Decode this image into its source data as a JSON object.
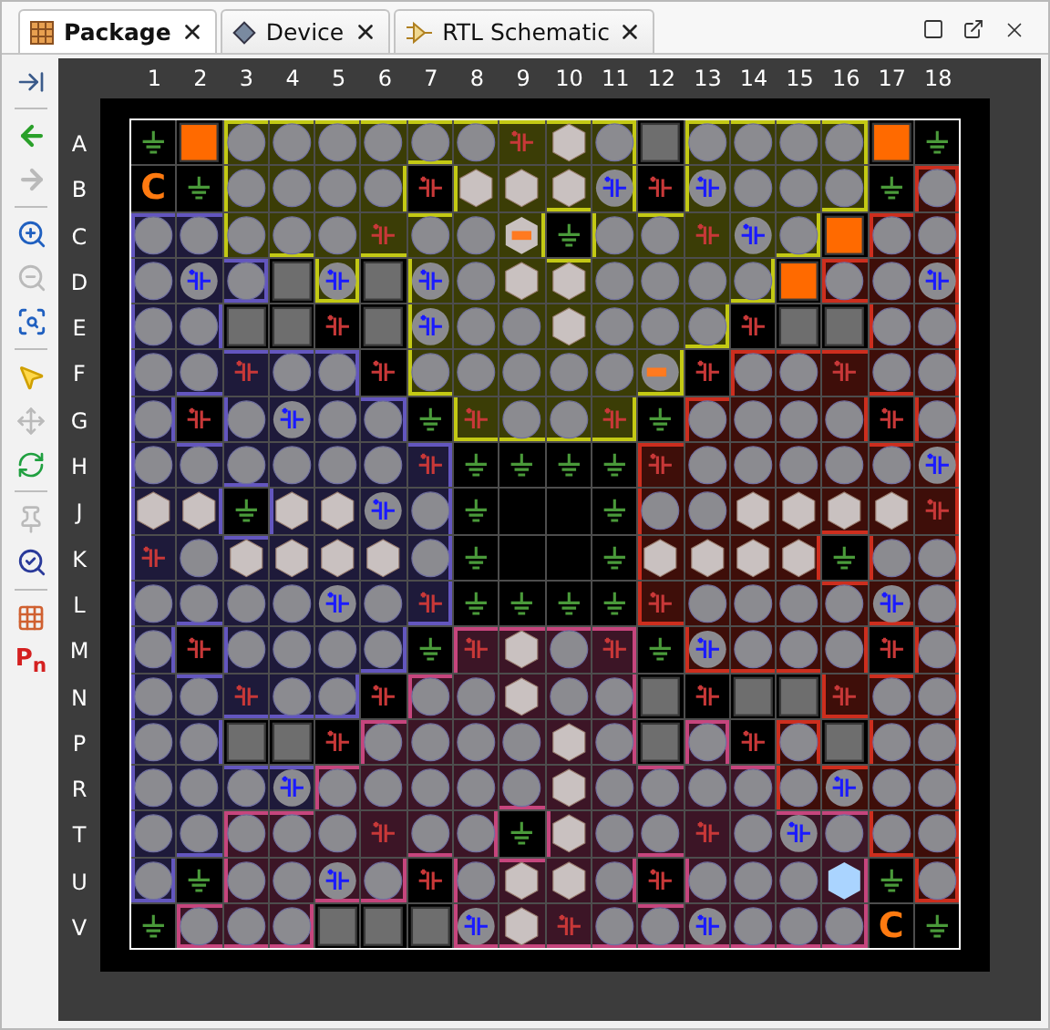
{
  "tabs": [
    {
      "label": "Package",
      "selected": true
    },
    {
      "label": "Device",
      "selected": false
    },
    {
      "label": "RTL Schematic",
      "selected": false
    }
  ],
  "toolbar": [
    {
      "disabled": false
    },
    {
      "disabled": false
    },
    {
      "disabled": true
    },
    {
      "disabled": false
    },
    {
      "disabled": true
    },
    {
      "disabled": false
    },
    {
      "disabled": false
    },
    {
      "disabled": true
    },
    {
      "disabled": false
    },
    {
      "disabled": true
    },
    {
      "disabled": false
    },
    {
      "disabled": false
    },
    {
      "disabled": false,
      "label": "P$_{n}$"
    }
  ],
  "columns": [
    "1",
    "2",
    "3",
    "4",
    "5",
    "6",
    "7",
    "8",
    "9",
    "10",
    "11",
    "12",
    "13",
    "14",
    "15",
    "16",
    "17",
    "18"
  ],
  "rows": [
    {
      "label": "A",
      "pins": [
        {
          "kind": "ground"
        },
        {
          "kind": "block"
        },
        {
          "kind": "circle",
          "color": "#3b3d06"
        },
        {
          "kind": "circle",
          "color": "#3b3d06"
        },
        {
          "kind": "circle",
          "color": "#3b3d06"
        },
        {
          "kind": "circle",
          "color": "#3b3d06"
        },
        {
          "kind": "circle",
          "color": "#3b3d06"
        },
        {
          "kind": "circle",
          "color": "#3b3d06"
        },
        {
          "kind": "power",
          "color": "#3b3d06"
        },
        {
          "kind": "hexagon",
          "color": "#3b3d06"
        },
        {
          "kind": "circle",
          "color": "#3b3d06"
        },
        {
          "kind": "square"
        },
        {
          "kind": "circle",
          "color": "#3b3d06"
        },
        {
          "kind": "circle",
          "color": "#3b3d06"
        },
        {
          "kind": "circle",
          "color": "#3b3d06"
        },
        {
          "kind": "circle",
          "color": "#3b3d06"
        },
        {
          "kind": "block"
        },
        {
          "kind": "ground"
        }
      ]
    },
    {
      "label": "B",
      "pins": [
        {
          "kind": "label",
          "text": "C"
        },
        {
          "kind": "ground"
        },
        {
          "kind": "circle",
          "color": "#3b3d06"
        },
        {
          "kind": "circle",
          "color": "#3b3d06"
        },
        {
          "kind": "circle",
          "color": "#3b3d06"
        },
        {
          "kind": "circle",
          "color": "#3b3d06"
        },
        {
          "kind": "power"
        },
        {
          "kind": "hexagon",
          "color": "#3b3d06"
        },
        {
          "kind": "hexagon",
          "color": "#3b3d06"
        },
        {
          "kind": "hexagon",
          "color": "#3b3d06"
        },
        {
          "kind": "capacitor",
          "color": "#3b3d06"
        },
        {
          "kind": "power"
        },
        {
          "kind": "capacitor",
          "color": "#3b3d06"
        },
        {
          "kind": "circle",
          "color": "#3b3d06"
        },
        {
          "kind": "circle",
          "color": "#3b3d06"
        },
        {
          "kind": "circle",
          "color": "#3b3d06"
        },
        {
          "kind": "ground"
        },
        {
          "kind": "circle",
          "color": "#3e0e09"
        }
      ]
    },
    {
      "label": "C",
      "pins": [
        {
          "kind": "circle",
          "color": "#1e1a3a"
        },
        {
          "kind": "circle",
          "color": "#1e1a3a"
        },
        {
          "kind": "circle",
          "color": "#3b3d06"
        },
        {
          "kind": "circle",
          "color": "#3b3d06"
        },
        {
          "kind": "circle",
          "color": "#3b3d06"
        },
        {
          "kind": "power",
          "color": "#3b3d06"
        },
        {
          "kind": "circle",
          "color": "#3b3d06"
        },
        {
          "kind": "circle",
          "color": "#3b3d06"
        },
        {
          "kind": "hexmark",
          "color": "#3b3d06"
        },
        {
          "kind": "ground"
        },
        {
          "kind": "circle",
          "color": "#3b3d06"
        },
        {
          "kind": "circle",
          "color": "#3b3d06"
        },
        {
          "kind": "power",
          "color": "#3b3d06"
        },
        {
          "kind": "capacitor",
          "color": "#3b3d06"
        },
        {
          "kind": "circle",
          "color": "#3b3d06"
        },
        {
          "kind": "block"
        },
        {
          "kind": "circle",
          "color": "#3e0e09"
        },
        {
          "kind": "circle",
          "color": "#3e0e09"
        }
      ]
    },
    {
      "label": "D",
      "pins": [
        {
          "kind": "circle",
          "color": "#1e1a3a"
        },
        {
          "kind": "capacitor",
          "color": "#1e1a3a"
        },
        {
          "kind": "circle",
          "color": "#1e1a3a"
        },
        {
          "kind": "square"
        },
        {
          "kind": "capacitor",
          "color": "#3b3d06"
        },
        {
          "kind": "square"
        },
        {
          "kind": "capacitor",
          "color": "#3b3d06"
        },
        {
          "kind": "circle",
          "color": "#3b3d06"
        },
        {
          "kind": "hexagon",
          "color": "#3b3d06"
        },
        {
          "kind": "hexagon",
          "color": "#3b3d06"
        },
        {
          "kind": "circle",
          "color": "#3b3d06"
        },
        {
          "kind": "circle",
          "color": "#3b3d06"
        },
        {
          "kind": "circle",
          "color": "#3b3d06"
        },
        {
          "kind": "circle",
          "color": "#3b3d06"
        },
        {
          "kind": "block"
        },
        {
          "kind": "circle",
          "color": "#3e0e09"
        },
        {
          "kind": "circle",
          "color": "#3e0e09"
        },
        {
          "kind": "capacitor",
          "color": "#3e0e09"
        }
      ]
    },
    {
      "label": "E",
      "pins": [
        {
          "kind": "circle",
          "color": "#1e1a3a"
        },
        {
          "kind": "circle",
          "color": "#1e1a3a"
        },
        {
          "kind": "square"
        },
        {
          "kind": "square"
        },
        {
          "kind": "power"
        },
        {
          "kind": "square"
        },
        {
          "kind": "capacitor",
          "color": "#3b3d06"
        },
        {
          "kind": "circle",
          "color": "#3b3d06"
        },
        {
          "kind": "circle",
          "color": "#3b3d06"
        },
        {
          "kind": "hexagon",
          "color": "#3b3d06"
        },
        {
          "kind": "circle",
          "color": "#3b3d06"
        },
        {
          "kind": "circle",
          "color": "#3b3d06"
        },
        {
          "kind": "circle",
          "color": "#3b3d06"
        },
        {
          "kind": "power"
        },
        {
          "kind": "square"
        },
        {
          "kind": "square"
        },
        {
          "kind": "circle",
          "color": "#3e0e09"
        },
        {
          "kind": "circle",
          "color": "#3e0e09"
        }
      ]
    },
    {
      "label": "F",
      "pins": [
        {
          "kind": "circle",
          "color": "#1e1a3a"
        },
        {
          "kind": "circle",
          "color": "#1e1a3a"
        },
        {
          "kind": "power",
          "color": "#1e1a3a"
        },
        {
          "kind": "circle",
          "color": "#1e1a3a"
        },
        {
          "kind": "circle",
          "color": "#1e1a3a"
        },
        {
          "kind": "power"
        },
        {
          "kind": "circle",
          "color": "#3b3d06"
        },
        {
          "kind": "circle",
          "color": "#3b3d06"
        },
        {
          "kind": "circle",
          "color": "#3b3d06"
        },
        {
          "kind": "circle",
          "color": "#3b3d06"
        },
        {
          "kind": "circle",
          "color": "#3b3d06"
        },
        {
          "kind": "circlemark",
          "color": "#3b3d06"
        },
        {
          "kind": "power"
        },
        {
          "kind": "circle",
          "color": "#3e0e09"
        },
        {
          "kind": "circle",
          "color": "#3e0e09"
        },
        {
          "kind": "power",
          "color": "#3e0e09"
        },
        {
          "kind": "circle",
          "color": "#3e0e09"
        },
        {
          "kind": "circle",
          "color": "#3e0e09"
        }
      ]
    },
    {
      "label": "G",
      "pins": [
        {
          "kind": "circle",
          "color": "#1e1a3a"
        },
        {
          "kind": "power"
        },
        {
          "kind": "circle",
          "color": "#1e1a3a"
        },
        {
          "kind": "capacitor",
          "color": "#1e1a3a"
        },
        {
          "kind": "circle",
          "color": "#1e1a3a"
        },
        {
          "kind": "circle",
          "color": "#1e1a3a"
        },
        {
          "kind": "ground"
        },
        {
          "kind": "power",
          "color": "#3b3d06"
        },
        {
          "kind": "circle",
          "color": "#3b3d06"
        },
        {
          "kind": "circle",
          "color": "#3b3d06"
        },
        {
          "kind": "power",
          "color": "#3b3d06"
        },
        {
          "kind": "ground"
        },
        {
          "kind": "circle",
          "color": "#3e0e09"
        },
        {
          "kind": "circle",
          "color": "#3e0e09"
        },
        {
          "kind": "circle",
          "color": "#3e0e09"
        },
        {
          "kind": "circle",
          "color": "#3e0e09"
        },
        {
          "kind": "power"
        },
        {
          "kind": "circle",
          "color": "#3e0e09"
        }
      ]
    },
    {
      "label": "H",
      "pins": [
        {
          "kind": "circle",
          "color": "#1e1a3a"
        },
        {
          "kind": "circle",
          "color": "#1e1a3a"
        },
        {
          "kind": "circle",
          "color": "#1e1a3a"
        },
        {
          "kind": "circle",
          "color": "#1e1a3a"
        },
        {
          "kind": "circle",
          "color": "#1e1a3a"
        },
        {
          "kind": "circle",
          "color": "#1e1a3a"
        },
        {
          "kind": "power",
          "color": "#1e1a3a"
        },
        {
          "kind": "ground"
        },
        {
          "kind": "ground"
        },
        {
          "kind": "ground"
        },
        {
          "kind": "ground"
        },
        {
          "kind": "power",
          "color": "#3e0e09"
        },
        {
          "kind": "circle",
          "color": "#3e0e09"
        },
        {
          "kind": "circle",
          "color": "#3e0e09"
        },
        {
          "kind": "circle",
          "color": "#3e0e09"
        },
        {
          "kind": "circle",
          "color": "#3e0e09"
        },
        {
          "kind": "circle",
          "color": "#3e0e09"
        },
        {
          "kind": "capacitor",
          "color": "#3e0e09"
        }
      ]
    },
    {
      "label": "J",
      "pins": [
        {
          "kind": "hexagon",
          "color": "#1e1a3a"
        },
        {
          "kind": "hexagon",
          "color": "#1e1a3a"
        },
        {
          "kind": "ground"
        },
        {
          "kind": "hexagon",
          "color": "#1e1a3a"
        },
        {
          "kind": "hexagon",
          "color": "#1e1a3a"
        },
        {
          "kind": "capacitor",
          "color": "#1e1a3a"
        },
        {
          "kind": "circle",
          "color": "#1e1a3a"
        },
        {
          "kind": "ground"
        },
        {
          "kind": "empty"
        },
        {
          "kind": "empty"
        },
        {
          "kind": "ground"
        },
        {
          "kind": "circle",
          "color": "#3e0e09"
        },
        {
          "kind": "circle",
          "color": "#3e0e09"
        },
        {
          "kind": "hexagon",
          "color": "#3e0e09"
        },
        {
          "kind": "hexagon",
          "color": "#3e0e09"
        },
        {
          "kind": "hexagon",
          "color": "#3e0e09"
        },
        {
          "kind": "hexagon",
          "color": "#3e0e09"
        },
        {
          "kind": "power",
          "color": "#3e0e09"
        }
      ]
    },
    {
      "label": "K",
      "pins": [
        {
          "kind": "power",
          "color": "#1e1a3a"
        },
        {
          "kind": "circle",
          "color": "#1e1a3a"
        },
        {
          "kind": "hexagon",
          "color": "#1e1a3a"
        },
        {
          "kind": "hexagon",
          "color": "#1e1a3a"
        },
        {
          "kind": "hexagon",
          "color": "#1e1a3a"
        },
        {
          "kind": "hexagon",
          "color": "#1e1a3a"
        },
        {
          "kind": "circle",
          "color": "#1e1a3a"
        },
        {
          "kind": "ground"
        },
        {
          "kind": "empty"
        },
        {
          "kind": "empty"
        },
        {
          "kind": "ground"
        },
        {
          "kind": "hexagon",
          "color": "#3e0e09"
        },
        {
          "kind": "hexagon",
          "color": "#3e0e09"
        },
        {
          "kind": "hexagon",
          "color": "#3e0e09"
        },
        {
          "kind": "hexagon",
          "color": "#3e0e09"
        },
        {
          "kind": "ground"
        },
        {
          "kind": "circle",
          "color": "#3e0e09"
        },
        {
          "kind": "circle",
          "color": "#3e0e09"
        }
      ]
    },
    {
      "label": "L",
      "pins": [
        {
          "kind": "circle",
          "color": "#1e1a3a"
        },
        {
          "kind": "circle",
          "color": "#1e1a3a"
        },
        {
          "kind": "circle",
          "color": "#1e1a3a"
        },
        {
          "kind": "circle",
          "color": "#1e1a3a"
        },
        {
          "kind": "capacitor",
          "color": "#1e1a3a"
        },
        {
          "kind": "circle",
          "color": "#1e1a3a"
        },
        {
          "kind": "power",
          "color": "#1e1a3a"
        },
        {
          "kind": "ground"
        },
        {
          "kind": "ground"
        },
        {
          "kind": "ground"
        },
        {
          "kind": "ground"
        },
        {
          "kind": "power",
          "color": "#3e0e09"
        },
        {
          "kind": "circle",
          "color": "#3e0e09"
        },
        {
          "kind": "circle",
          "color": "#3e0e09"
        },
        {
          "kind": "circle",
          "color": "#3e0e09"
        },
        {
          "kind": "circle",
          "color": "#3e0e09"
        },
        {
          "kind": "capacitor",
          "color": "#3e0e09"
        },
        {
          "kind": "circle",
          "color": "#3e0e09"
        }
      ]
    },
    {
      "label": "M",
      "pins": [
        {
          "kind": "circle",
          "color": "#1e1a3a"
        },
        {
          "kind": "power"
        },
        {
          "kind": "circle",
          "color": "#1e1a3a"
        },
        {
          "kind": "circle",
          "color": "#1e1a3a"
        },
        {
          "kind": "circle",
          "color": "#1e1a3a"
        },
        {
          "kind": "circle",
          "color": "#1e1a3a"
        },
        {
          "kind": "ground"
        },
        {
          "kind": "power",
          "color": "#3c1526"
        },
        {
          "kind": "hexagon",
          "color": "#3c1526"
        },
        {
          "kind": "circle",
          "color": "#3c1526"
        },
        {
          "kind": "power",
          "color": "#3c1526"
        },
        {
          "kind": "ground"
        },
        {
          "kind": "capacitor",
          "color": "#3e0e09"
        },
        {
          "kind": "circle",
          "color": "#3e0e09"
        },
        {
          "kind": "circle",
          "color": "#3e0e09"
        },
        {
          "kind": "circle",
          "color": "#3e0e09"
        },
        {
          "kind": "power"
        },
        {
          "kind": "circle",
          "color": "#3e0e09"
        }
      ]
    },
    {
      "label": "N",
      "pins": [
        {
          "kind": "circle",
          "color": "#1e1a3a"
        },
        {
          "kind": "circle",
          "color": "#1e1a3a"
        },
        {
          "kind": "power",
          "color": "#1e1a3a"
        },
        {
          "kind": "circle",
          "color": "#1e1a3a"
        },
        {
          "kind": "circle",
          "color": "#1e1a3a"
        },
        {
          "kind": "power"
        },
        {
          "kind": "circle",
          "color": "#3c1526"
        },
        {
          "kind": "circle",
          "color": "#3c1526"
        },
        {
          "kind": "hexagon",
          "color": "#3c1526"
        },
        {
          "kind": "circle",
          "color": "#3c1526"
        },
        {
          "kind": "circle",
          "color": "#3c1526"
        },
        {
          "kind": "square"
        },
        {
          "kind": "power"
        },
        {
          "kind": "square"
        },
        {
          "kind": "square"
        },
        {
          "kind": "power",
          "color": "#3e0e09"
        },
        {
          "kind": "circle",
          "color": "#3e0e09"
        },
        {
          "kind": "circle",
          "color": "#3e0e09"
        }
      ]
    },
    {
      "label": "P",
      "pins": [
        {
          "kind": "circle",
          "color": "#1e1a3a"
        },
        {
          "kind": "circle",
          "color": "#1e1a3a"
        },
        {
          "kind": "square"
        },
        {
          "kind": "square"
        },
        {
          "kind": "power"
        },
        {
          "kind": "circle",
          "color": "#3c1526"
        },
        {
          "kind": "circle",
          "color": "#3c1526"
        },
        {
          "kind": "circle",
          "color": "#3c1526"
        },
        {
          "kind": "circle",
          "color": "#3c1526"
        },
        {
          "kind": "hexagon",
          "color": "#3c1526"
        },
        {
          "kind": "circle",
          "color": "#3c1526"
        },
        {
          "kind": "square"
        },
        {
          "kind": "circle",
          "color": "#3c1526"
        },
        {
          "kind": "power"
        },
        {
          "kind": "circle",
          "color": "#3e0e09"
        },
        {
          "kind": "square"
        },
        {
          "kind": "circle",
          "color": "#3e0e09"
        },
        {
          "kind": "circle",
          "color": "#3e0e09"
        }
      ]
    },
    {
      "label": "R",
      "pins": [
        {
          "kind": "circle",
          "color": "#1e1a3a"
        },
        {
          "kind": "circle",
          "color": "#1e1a3a"
        },
        {
          "kind": "circle",
          "color": "#1e1a3a"
        },
        {
          "kind": "capacitor",
          "color": "#1e1a3a"
        },
        {
          "kind": "circle",
          "color": "#3c1526"
        },
        {
          "kind": "circle",
          "color": "#3c1526"
        },
        {
          "kind": "circle",
          "color": "#3c1526"
        },
        {
          "kind": "circle",
          "color": "#3c1526"
        },
        {
          "kind": "circle",
          "color": "#3c1526"
        },
        {
          "kind": "hexagon",
          "color": "#3c1526"
        },
        {
          "kind": "circle",
          "color": "#3c1526"
        },
        {
          "kind": "circle",
          "color": "#3c1526"
        },
        {
          "kind": "circle",
          "color": "#3c1526"
        },
        {
          "kind": "circle",
          "color": "#3c1526"
        },
        {
          "kind": "circle",
          "color": "#3e0e09"
        },
        {
          "kind": "capacitor",
          "color": "#3e0e09"
        },
        {
          "kind": "circle",
          "color": "#3e0e09"
        },
        {
          "kind": "circle",
          "color": "#3e0e09"
        }
      ]
    },
    {
      "label": "T",
      "pins": [
        {
          "kind": "circle",
          "color": "#1e1a3a"
        },
        {
          "kind": "circle",
          "color": "#1e1a3a"
        },
        {
          "kind": "circle",
          "color": "#3c1526"
        },
        {
          "kind": "circle",
          "color": "#3c1526"
        },
        {
          "kind": "circle",
          "color": "#3c1526"
        },
        {
          "kind": "power",
          "color": "#3c1526"
        },
        {
          "kind": "circle",
          "color": "#3c1526"
        },
        {
          "kind": "circle",
          "color": "#3c1526"
        },
        {
          "kind": "ground"
        },
        {
          "kind": "hexagon",
          "color": "#3c1526"
        },
        {
          "kind": "circle",
          "color": "#3c1526"
        },
        {
          "kind": "circle",
          "color": "#3c1526"
        },
        {
          "kind": "power",
          "color": "#3c1526"
        },
        {
          "kind": "circle",
          "color": "#3c1526"
        },
        {
          "kind": "capacitor",
          "color": "#3c1526"
        },
        {
          "kind": "circle",
          "color": "#3c1526"
        },
        {
          "kind": "circle",
          "color": "#3e0e09"
        },
        {
          "kind": "circle",
          "color": "#3e0e09"
        }
      ]
    },
    {
      "label": "U",
      "pins": [
        {
          "kind": "circle",
          "color": "#1e1a3a"
        },
        {
          "kind": "ground"
        },
        {
          "kind": "circle",
          "color": "#3c1526"
        },
        {
          "kind": "circle",
          "color": "#3c1526"
        },
        {
          "kind": "capacitor",
          "color": "#3c1526"
        },
        {
          "kind": "circle",
          "color": "#3c1526"
        },
        {
          "kind": "power"
        },
        {
          "kind": "circle",
          "color": "#3c1526"
        },
        {
          "kind": "hexagon",
          "color": "#3c1526"
        },
        {
          "kind": "hexagon",
          "color": "#3c1526"
        },
        {
          "kind": "circle",
          "color": "#3c1526"
        },
        {
          "kind": "power"
        },
        {
          "kind": "circle",
          "color": "#3c1526"
        },
        {
          "kind": "circle",
          "color": "#3c1526"
        },
        {
          "kind": "circle",
          "color": "#3c1526"
        },
        {
          "kind": "lighthex",
          "color": "#3c1526"
        },
        {
          "kind": "ground"
        },
        {
          "kind": "circle",
          "color": "#3e0e09"
        }
      ]
    },
    {
      "label": "V",
      "pins": [
        {
          "kind": "ground"
        },
        {
          "kind": "circle",
          "color": "#3c1526"
        },
        {
          "kind": "circle",
          "color": "#3c1526"
        },
        {
          "kind": "circle",
          "color": "#3c1526"
        },
        {
          "kind": "square"
        },
        {
          "kind": "square"
        },
        {
          "kind": "square"
        },
        {
          "kind": "capacitor",
          "color": "#3c1526"
        },
        {
          "kind": "hexagon",
          "color": "#3c1526"
        },
        {
          "kind": "power",
          "color": "#3c1526"
        },
        {
          "kind": "circle",
          "color": "#3c1526"
        },
        {
          "kind": "circle",
          "color": "#3c1526"
        },
        {
          "kind": "capacitor",
          "color": "#3c1526"
        },
        {
          "kind": "circle",
          "color": "#3c1526"
        },
        {
          "kind": "circle",
          "color": "#3c1526"
        },
        {
          "kind": "circle",
          "color": "#3c1526"
        },
        {
          "kind": "label",
          "text": "C"
        },
        {
          "kind": "ground"
        }
      ]
    }
  ]
}
